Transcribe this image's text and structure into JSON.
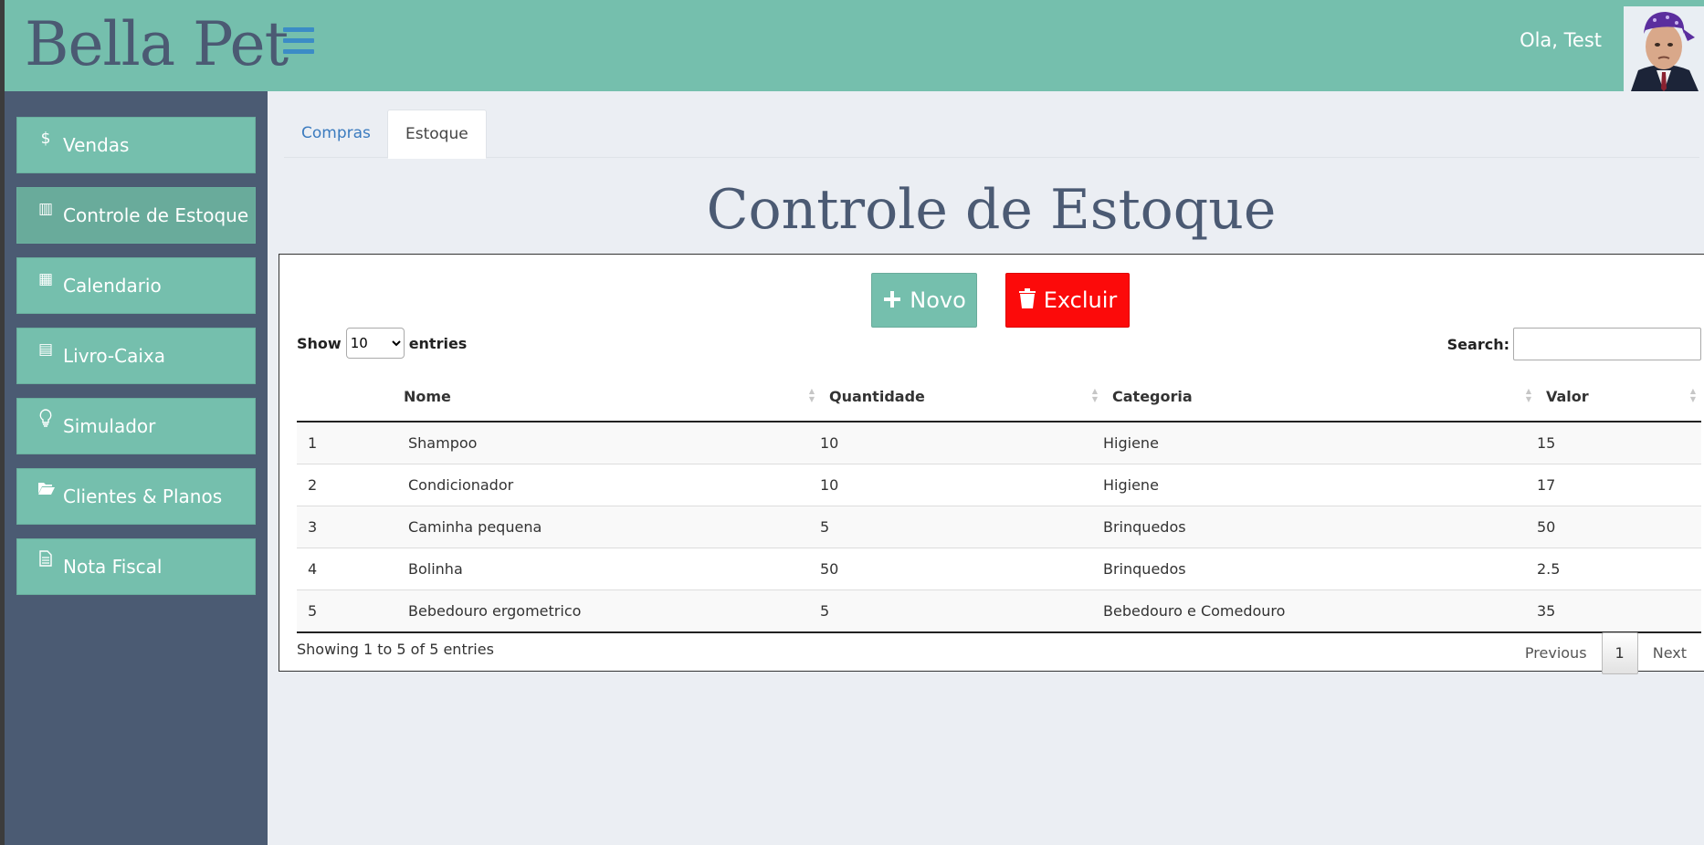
{
  "header": {
    "brand": "Bella Pet",
    "greeting": "Ola, Test"
  },
  "sidebar": {
    "items": [
      {
        "label": "Vendas",
        "icon": "dollar-icon",
        "glyph": "$"
      },
      {
        "label": "Controle de Estoque",
        "icon": "chart-icon",
        "glyph": "▥"
      },
      {
        "label": "Calendario",
        "icon": "calendar-icon",
        "glyph": "▦"
      },
      {
        "label": "Livro-Caixa",
        "icon": "cash-register-icon",
        "glyph": "▤"
      },
      {
        "label": "Simulador",
        "icon": "lightbulb-icon",
        "glyph": "💡"
      },
      {
        "label": "Clientes & Planos",
        "icon": "folder-open-icon",
        "glyph": "📂"
      },
      {
        "label": "Nota Fiscal",
        "icon": "file-icon",
        "glyph": "📄"
      }
    ]
  },
  "tabs": [
    {
      "label": "Compras"
    },
    {
      "label": "Estoque"
    }
  ],
  "page": {
    "title": "Controle de Estoque"
  },
  "toolbar": {
    "novo_label": "Novo",
    "excluir_label": "Excluir"
  },
  "table_controls": {
    "show_label": "Show",
    "entries_label": "entries",
    "page_size": "10",
    "search_label": "Search:"
  },
  "table": {
    "columns": [
      "",
      "Nome",
      "Quantidade",
      "Categoria",
      "Valor"
    ],
    "rows": [
      [
        "1",
        "Shampoo",
        "10",
        "Higiene",
        "15"
      ],
      [
        "2",
        "Condicionador",
        "10",
        "Higiene",
        "17"
      ],
      [
        "3",
        "Caminha pequena",
        "5",
        "Brinquedos",
        "50"
      ],
      [
        "4",
        "Bolinha",
        "50",
        "Brinquedos",
        "2.5"
      ],
      [
        "5",
        "Bebedouro ergometrico",
        "5",
        "Bebedouro e Comedouro",
        "35"
      ]
    ]
  },
  "footer": {
    "info": "Showing 1 to 5 of 5 entries",
    "previous": "Previous",
    "current_page": "1",
    "next": "Next"
  }
}
